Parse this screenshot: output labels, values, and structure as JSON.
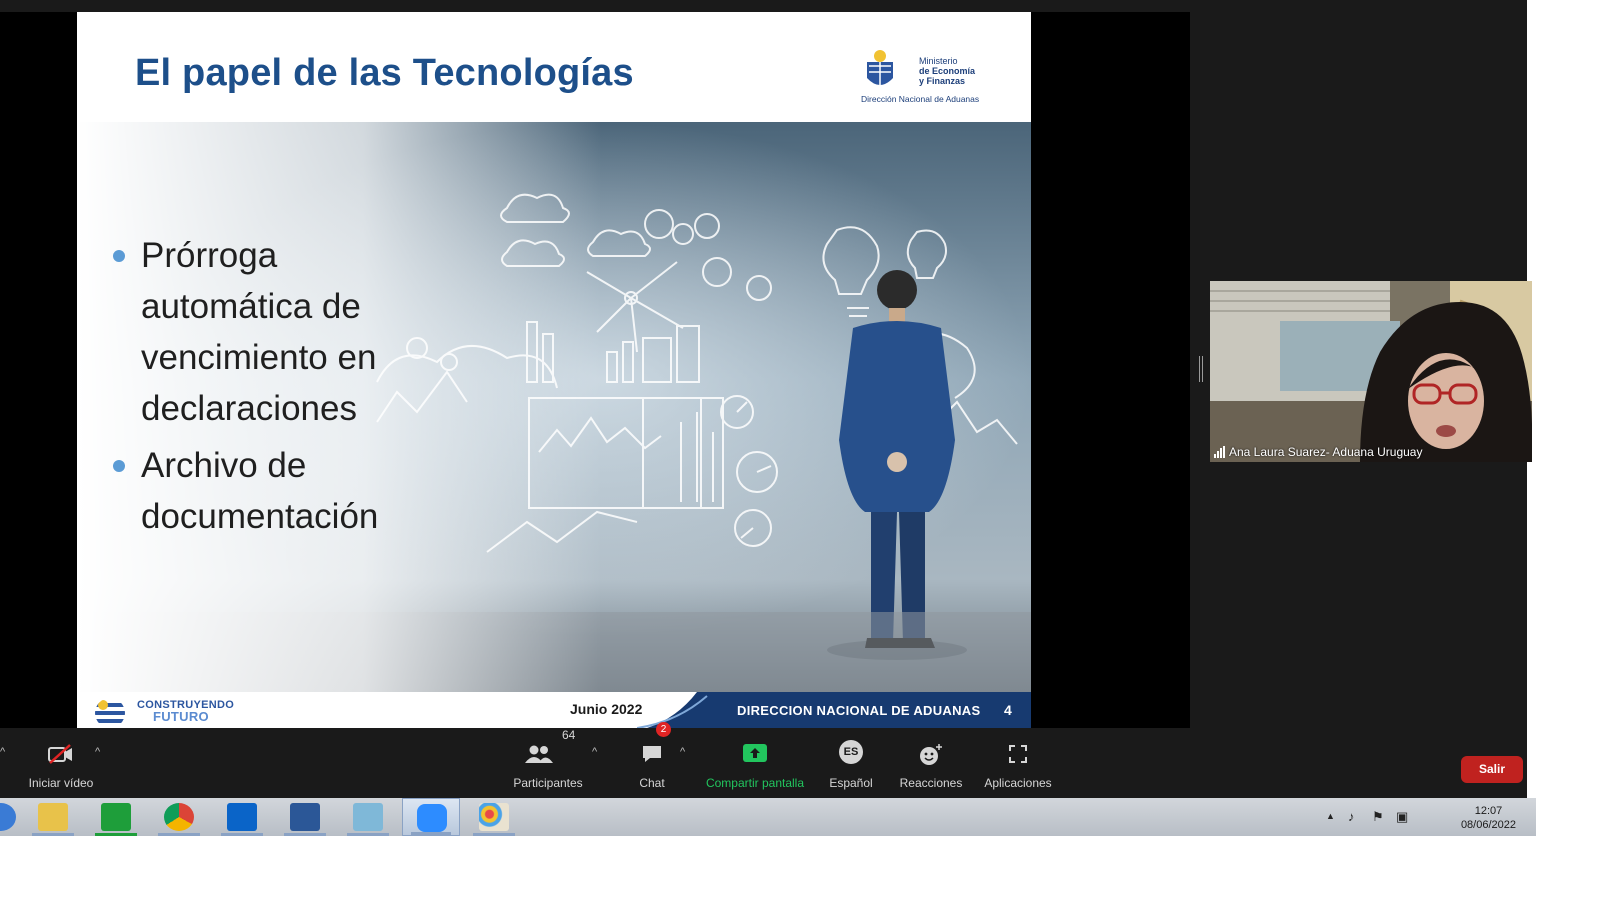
{
  "slide": {
    "title": "El papel de las Tecnologías",
    "logo_ministerio_lines": [
      "Ministerio",
      "de Economía",
      "y Finanzas"
    ],
    "logo_direccion": "Dirección Nacional de Aduanas",
    "bullets": [
      "Prórroga automática de vencimiento en declaraciones",
      "Archivo de documentación"
    ],
    "footer_logo_line1": "CONSTRUYENDO",
    "footer_logo_line2": "FUTURO",
    "footer_date": "Junio 2022",
    "footer_org": "DIRECCION NACIONAL DE ADUANAS",
    "footer_page": "4"
  },
  "participant": {
    "name": "Ana Laura Suarez- Aduana Uruguay"
  },
  "controls": {
    "video_label": "Iniciar vídeo",
    "participants_label": "Participantes",
    "participants_count": "64",
    "chat_label": "Chat",
    "chat_badge": "2",
    "share_label": "Compartir pantalla",
    "language_badge": "ES",
    "language_label": "Español",
    "reactions_label": "Reacciones",
    "apps_label": "Aplicaciones",
    "leave_label": "Salir"
  },
  "taskbar": {
    "apps": [
      "file-explorer-icon",
      "store-icon",
      "chrome-icon",
      "outlook-icon",
      "word-icon",
      "notes-icon",
      "zoom-icon",
      "paint-icon"
    ],
    "time": "12:07",
    "date": "08/06/2022"
  },
  "colors": {
    "slide_title": "#1d4f8a",
    "share_button": "#22c55e",
    "leave_button": "#c0221f",
    "chat_badge": "#e02424"
  }
}
